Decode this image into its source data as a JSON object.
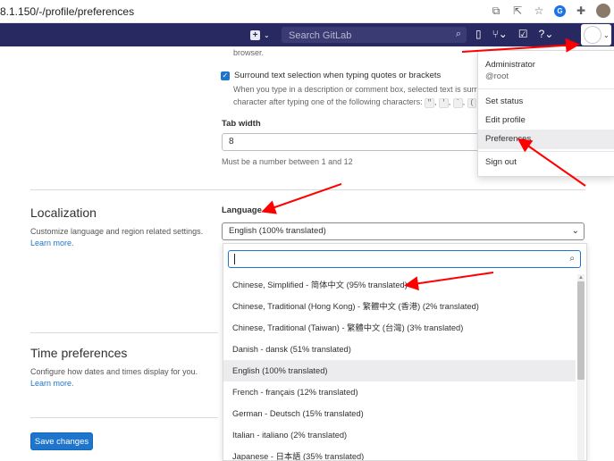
{
  "browser": {
    "url": "8.1.150/-/profile/preferences"
  },
  "topnav": {
    "search_placeholder": "Search GitLab"
  },
  "editor": {
    "browser_text": "browser.",
    "surround_label": "Surround text selection when typing quotes or brackets",
    "surround_help_1": "When you type in a description or comment box, selected text is surr",
    "surround_help_2": "character after typing one of the following characters:",
    "keys": [
      "\"",
      "'",
      "`",
      "("
    ],
    "tab_width_label": "Tab width",
    "tab_width_value": "8",
    "tab_width_help": "Must be a number between 1 and 12"
  },
  "localization": {
    "title": "Localization",
    "description": "Customize language and region related settings.",
    "learn_more": "Learn more.",
    "language_label": "Language",
    "selected_language": "English (100% translated)",
    "options": [
      "Chinese, Simplified - 简体中文 (95% translated)",
      "Chinese, Traditional (Hong Kong) - 繁體中文 (香港) (2% translated)",
      "Chinese, Traditional (Taiwan) - 繁體中文 (台灣) (3% translated)",
      "Danish - dansk (51% translated)",
      "English (100% translated)",
      "French - français (12% translated)",
      "German - Deutsch (15% translated)",
      "Italian - italiano (2% translated)",
      "Japanese - 日本語 (35% translated)"
    ]
  },
  "time_preferences": {
    "title": "Time preferences",
    "description": "Configure how dates and times display for you.",
    "learn_more": "Learn more."
  },
  "save_label": "Save changes",
  "user_menu": {
    "name": "Administrator",
    "handle": "@root",
    "set_status": "Set status",
    "edit_profile": "Edit profile",
    "preferences": "Preferences",
    "sign_out": "Sign out"
  },
  "colors": {
    "nav_bg": "#292961",
    "primary": "#1f75cb",
    "annotation_arrow": "#ff0000"
  }
}
